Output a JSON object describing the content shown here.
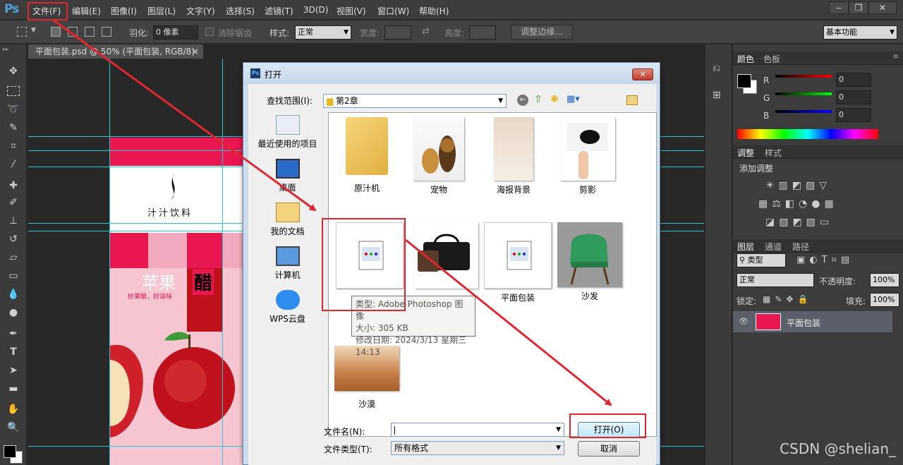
{
  "app": {
    "logo": "Ps"
  },
  "menubar": {
    "items": [
      "文件(F)",
      "编辑(E)",
      "图像(I)",
      "图层(L)",
      "文字(Y)",
      "选择(S)",
      "滤镜(T)",
      "3D(D)",
      "视图(V)",
      "窗口(W)",
      "帮助(H)"
    ],
    "window_buttons": [
      "‒",
      "❐",
      "✕"
    ]
  },
  "options": {
    "feather_label": "羽化:",
    "feather_value": "0 像素",
    "antialias_label": "消除锯齿",
    "style_label": "样式:",
    "style_value": "正常",
    "width_label": "宽度:",
    "height_label": "高度:",
    "refine_button": "调整边缘...",
    "workspace": "基本功能"
  },
  "document": {
    "tab_title": "平面包装.psd @ 50% (平面包装, RGB/8)",
    "tab_close": "×",
    "artwork": {
      "brand": "汁汁饮料",
      "headline": "苹果",
      "slogan": "好果酿，好滋味",
      "badge": "醋"
    }
  },
  "color_panel": {
    "tabs": [
      "颜色",
      "色板"
    ],
    "channels": [
      {
        "label": "R",
        "value": "0"
      },
      {
        "label": "G",
        "value": "0"
      },
      {
        "label": "B",
        "value": "0"
      }
    ],
    "foreground": "#000000",
    "background": "#ffffff"
  },
  "adjust_panel": {
    "tabs": [
      "调整",
      "样式"
    ],
    "title": "添加调整"
  },
  "layers_panel": {
    "tabs": [
      "图层",
      "通道",
      "路径"
    ],
    "filter_kind": "类型",
    "blend_mode": "正常",
    "opacity_label": "不透明度:",
    "opacity_value": "100%",
    "lock_label": "锁定:",
    "fill_label": "填充:",
    "fill_value": "100%",
    "layers": [
      {
        "name": "平面包装"
      }
    ]
  },
  "dialog": {
    "title": "打开",
    "close": "✕",
    "look_in_label": "查找范围(I):",
    "look_in_value": "第2章",
    "places": [
      "最近使用的项目",
      "桌面",
      "我的文档",
      "计算机",
      "WPS云盘"
    ],
    "files": [
      {
        "name": "原汁机",
        "kind": "folder"
      },
      {
        "name": "宠物",
        "kind": "image"
      },
      {
        "name": "海报背景",
        "kind": "image"
      },
      {
        "name": "剪影",
        "kind": "image"
      },
      {
        "name": "",
        "kind": "psd"
      },
      {
        "name": "",
        "kind": "image"
      },
      {
        "name": "平面包装",
        "kind": "psd"
      },
      {
        "name": "沙发",
        "kind": "image"
      },
      {
        "name": "沙漠",
        "kind": "image"
      }
    ],
    "tooltip": {
      "type": "类型: Adobe Photoshop 图像",
      "size": "大小: 305 KB",
      "modified": "修改日期: 2024/3/13 星期三 14:13"
    },
    "filename_label": "文件名(N):",
    "filename_value": "",
    "filetype_label": "文件类型(T):",
    "filetype_value": "所有格式",
    "open_button": "打开(O)",
    "cancel_button": "取消"
  },
  "annotation_color": "#e0262e",
  "watermark": "CSDN @shelian_"
}
